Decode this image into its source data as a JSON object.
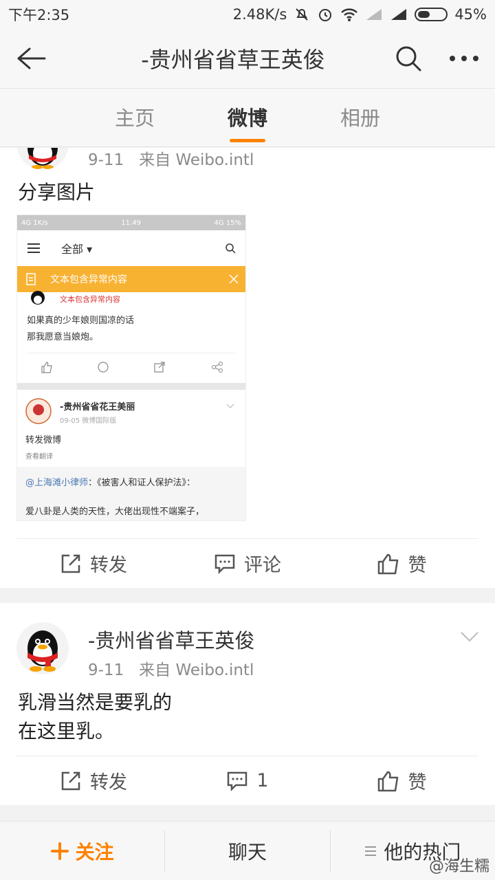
{
  "status": {
    "time": "下午2:35",
    "speed": "2.48K/s",
    "battery": "45%",
    "battery_level": 0.45
  },
  "header": {
    "title": "-贵州省省草王英俊"
  },
  "tabs": [
    {
      "label": "主页"
    },
    {
      "label": "微博"
    },
    {
      "label": "相册"
    }
  ],
  "post1": {
    "date": "9-11",
    "source": "来自 Weibo.intl",
    "text": "分享图片",
    "actions": {
      "repost": "转发",
      "comment": "评论",
      "like": "赞"
    }
  },
  "embedded": {
    "status_left": "4G 1K/s",
    "status_time": "11:49",
    "status_right": "4G 15%",
    "menu_label": "全部 ▾",
    "banner": "文本包含异常内容",
    "sub_warning": "文本包含异常内容",
    "text_line1": "如果真的少年娘则国凉的话",
    "text_line2": "那我愿意当娘炮。",
    "user2": "-贵州省省花王美丽",
    "user2_meta": "09-05  微博国际版",
    "repost_text": "转发微博",
    "translate": "查看翻译",
    "quote_mention": "@上海滩小律师",
    "quote_rest": "：《被害人和证人保护法》：",
    "quote_line2": "爱八卦是人类的天性，大佬出现性不端案子，"
  },
  "post2": {
    "username": "-贵州省省草王英俊",
    "date": "9-11",
    "source": "来自 Weibo.intl",
    "text_line1": "乳滑当然是要乳的",
    "text_line2": "在这里乳。",
    "actions": {
      "repost": "转发",
      "comment": "1",
      "like": "赞"
    }
  },
  "footer": {
    "follow": "关注",
    "chat": "聊天",
    "hot": "他的热门",
    "watermark": "@海生糯"
  }
}
